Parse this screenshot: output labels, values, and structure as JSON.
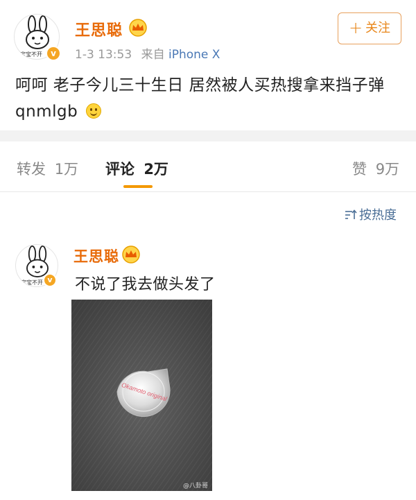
{
  "post": {
    "author": "王思聪",
    "avatar_caption": "宝宝不开",
    "timestamp": "1-3 13:53",
    "source_prefix": "来自",
    "source_device": "iPhone X",
    "follow_plus": "+",
    "follow_label": "关注",
    "text": "呵呵 老子今儿三十生日 居然被人买热搜拿来挡子弹 qnmlgb",
    "emoji": "smile-emoji"
  },
  "tabs": [
    {
      "label": "转发",
      "count": "1万"
    },
    {
      "label": "评论",
      "count": "2万"
    },
    {
      "label": "赞",
      "count": "9万"
    }
  ],
  "sort": {
    "label": "按热度"
  },
  "comment": {
    "author": "王思聪",
    "avatar_caption": "宝宝不开",
    "text": "不说了我去做头发了",
    "image_label": "Okamoto original",
    "watermark": "@八卦哥"
  },
  "colors": {
    "username": "#e86b0a",
    "follow_border": "#e8a05c",
    "tab_indicator": "#f39800",
    "source_link": "#4a78b5",
    "sort_link": "#4a6e96"
  }
}
